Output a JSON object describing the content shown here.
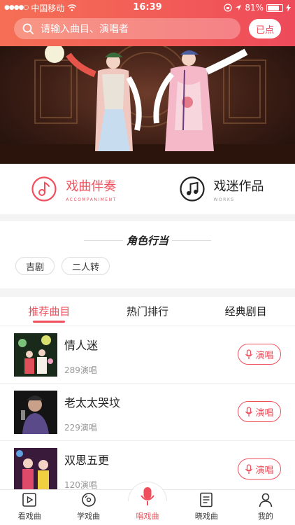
{
  "status": {
    "carrier": "中国移动",
    "time": "16:39",
    "battery": "81%",
    "battery_level": 0.81
  },
  "search": {
    "placeholder": "请输入曲目、演唱者",
    "button": "已点"
  },
  "categories": [
    {
      "title": "戏曲伴奏",
      "subtitle": "ACCOMPANIMENT",
      "icon": "music-note-circle-icon"
    },
    {
      "title": "戏迷作品",
      "subtitle": "WORKS",
      "icon": "music-note-circle-icon"
    }
  ],
  "roles": {
    "title": "角色行当",
    "tags": [
      "吉剧",
      "二人转"
    ]
  },
  "tabs": [
    "推荐曲目",
    "热门排行",
    "经典剧目"
  ],
  "songs": [
    {
      "title": "情人迷",
      "count": "289演唱",
      "action": "演唱"
    },
    {
      "title": "老太太哭坟",
      "count": "229演唱",
      "action": "演唱"
    },
    {
      "title": "双思五更",
      "count": "120演唱",
      "action": "演唱"
    }
  ],
  "tabbar": [
    {
      "label": "看戏曲",
      "icon": "play-video-icon"
    },
    {
      "label": "学戏曲",
      "icon": "disc-icon"
    },
    {
      "label": "唱戏曲",
      "icon": "microphone-icon"
    },
    {
      "label": "晓戏曲",
      "icon": "document-icon"
    },
    {
      "label": "我的",
      "icon": "person-icon"
    }
  ],
  "colors": {
    "accent": "#ef4f5c",
    "header_start": "#f56f55",
    "header_end": "#ee4a5a"
  }
}
